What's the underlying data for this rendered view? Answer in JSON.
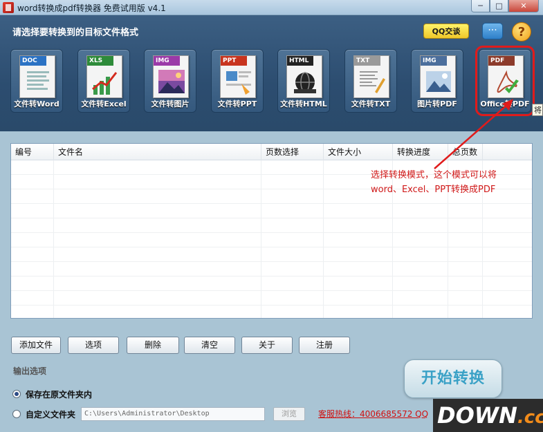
{
  "window": {
    "title": "word转换成pdf转换器 免费试用版 v4.1",
    "min_glyph": "─",
    "max_glyph": "□",
    "close_glyph": "✕"
  },
  "header": {
    "title": "请选择要转换到的目标文件格式",
    "qq_label": "QQ交谈",
    "chat_glyph": "···",
    "help_glyph": "?",
    "tooltip_fragment": "将"
  },
  "tiles": [
    {
      "tag": "DOC",
      "label": "文件转Word",
      "tag_color": "#2b72c4",
      "icon": "word-doc-icon"
    },
    {
      "tag": "XLS",
      "label": "文件转Excel",
      "tag_color": "#2e8b3a",
      "icon": "excel-chart-icon"
    },
    {
      "tag": "IMG",
      "label": "文件转图片",
      "tag_color": "#9b3aa8",
      "icon": "image-file-icon"
    },
    {
      "tag": "PPT",
      "label": "文件转PPT",
      "tag_color": "#c8341f",
      "icon": "ppt-file-icon"
    },
    {
      "tag": "HTML",
      "label": "文件转HTML",
      "tag_color": "#222222",
      "icon": "html-globe-icon"
    },
    {
      "tag": "TXT",
      "label": "文件转TXT",
      "tag_color": "#9a9a9a",
      "icon": "txt-file-icon"
    },
    {
      "tag": "IMG",
      "label": "图片转PDF",
      "tag_color": "#4b6e9c",
      "icon": "image-to-pdf-icon"
    },
    {
      "tag": "PDF",
      "label": "Office转PDF",
      "tag_color": "#8c3b2b",
      "icon": "office-to-pdf-icon",
      "selected": true
    }
  ],
  "table": {
    "columns": [
      "编号",
      "文件名",
      "页数选择",
      "文件大小",
      "转换进度",
      "总页数"
    ],
    "rows": []
  },
  "annotation": {
    "line1": "选择转换模式，这个模式可以将",
    "line2": "word、Excel、PPT转换成PDF"
  },
  "buttons": {
    "add": "添加文件",
    "options": "选项",
    "delete": "删除",
    "clear": "清空",
    "about": "关于",
    "register": "注册"
  },
  "output": {
    "title": "输出选项",
    "option_same": "保存在原文件夹内",
    "option_custom": "自定义文件夹",
    "selected": "same",
    "path": "C:\\Users\\Administrator\\Desktop",
    "browse": "浏览",
    "hotline": "客服热线：4006685572 QQ"
  },
  "start_button": "开始转换",
  "watermark": {
    "main": "DOWN",
    "suffix": ".cc"
  },
  "colors": {
    "accent_red": "#d01818",
    "header_blue": "#2c4d70",
    "background": "#a9c4d4"
  }
}
